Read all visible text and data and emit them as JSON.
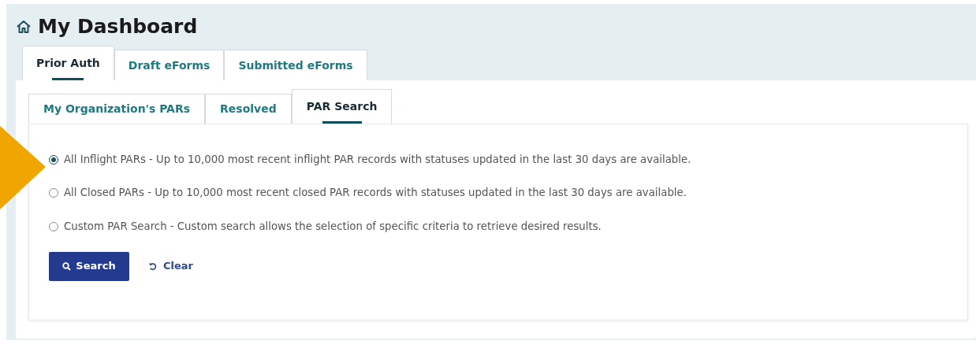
{
  "page": {
    "title": "My Dashboard"
  },
  "tabs": [
    {
      "label": "Prior Auth",
      "selected": true
    },
    {
      "label": "Draft eForms",
      "selected": false
    },
    {
      "label": "Submitted eForms",
      "selected": false
    }
  ],
  "subtabs": [
    {
      "label": "My Organization's PARs",
      "selected": false
    },
    {
      "label": "Resolved",
      "selected": false
    },
    {
      "label": "PAR Search",
      "selected": true
    }
  ],
  "options": [
    {
      "label": "All Inflight PARs - Up to 10,000 most recent inflight PAR records with statuses updated in the last 30 days are available.",
      "selected": true
    },
    {
      "label": "All Closed PARs - Up to 10,000 most recent closed PAR records with statuses updated in the last 30 days are available.",
      "selected": false
    },
    {
      "label": "Custom PAR Search - Custom search allows the selection of specific criteria to retrieve desired results.",
      "selected": false
    }
  ],
  "buttons": {
    "search": "Search",
    "clear": "Clear"
  }
}
